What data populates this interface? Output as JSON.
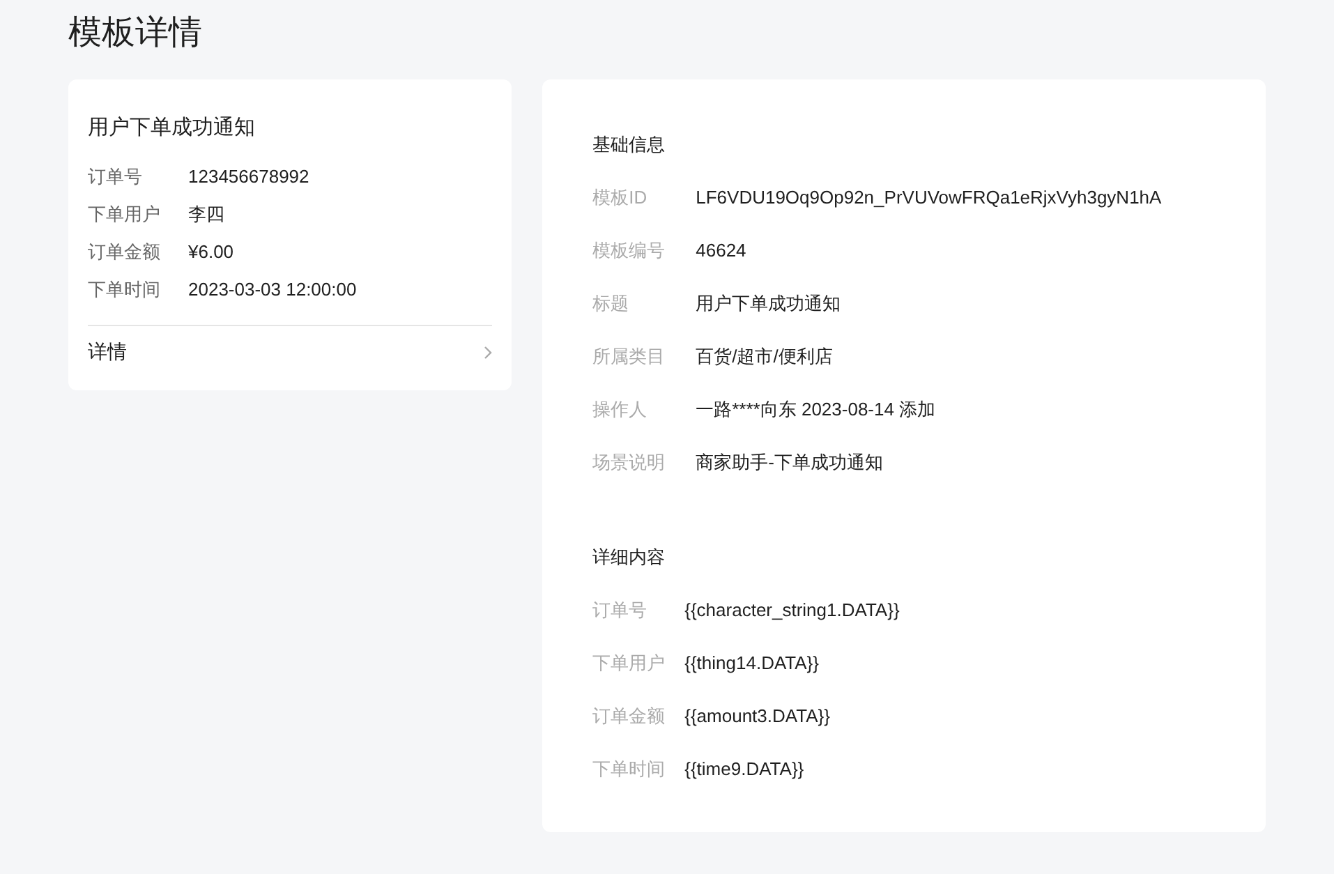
{
  "page_title": "模板详情",
  "preview": {
    "title": "用户下单成功通知",
    "fields": [
      {
        "label": "订单号",
        "value": "123456678992"
      },
      {
        "label": "下单用户",
        "value": "李四"
      },
      {
        "label": "订单金额",
        "value": "¥6.00"
      },
      {
        "label": "下单时间",
        "value": "2023-03-03 12:00:00"
      }
    ],
    "link": "详情"
  },
  "basic_info": {
    "heading": "基础信息",
    "fields": [
      {
        "label": "模板ID",
        "value": "LF6VDU19Oq9Op92n_PrVUVowFRQa1eRjxVyh3gyN1hA"
      },
      {
        "label": "模板编号",
        "value": "46624"
      },
      {
        "label": "标题",
        "value": "用户下单成功通知"
      },
      {
        "label": "所属类目",
        "value": "百货/超市/便利店"
      },
      {
        "label": "操作人",
        "value": "一路****向东 2023-08-14 添加"
      },
      {
        "label": "场景说明",
        "value": "商家助手-下单成功通知"
      }
    ]
  },
  "detail_content": {
    "heading": "详细内容",
    "fields": [
      {
        "label": "订单号",
        "value": "{{character_string1.DATA}}"
      },
      {
        "label": "下单用户",
        "value": "{{thing14.DATA}}"
      },
      {
        "label": "订单金额",
        "value": "{{amount3.DATA}}"
      },
      {
        "label": "下单时间",
        "value": "{{time9.DATA}}"
      }
    ]
  }
}
